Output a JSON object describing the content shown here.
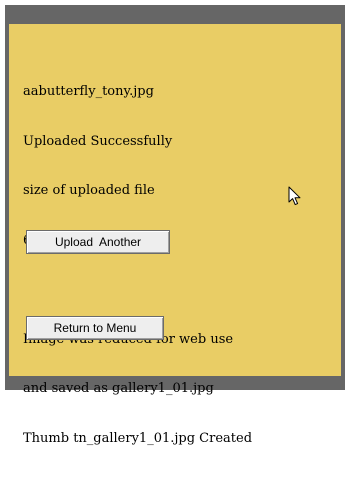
{
  "result": {
    "lines": [
      "aabutterfly_tony.jpg",
      "Uploaded Successfully",
      "size of uploaded file",
      "626 x 900",
      "",
      "Image was reduced for web use",
      "and saved as gallery1_01.jpg",
      "Thumb tn_gallery1_01.jpg Created"
    ]
  },
  "buttons": {
    "upload_another": "Upload  Another",
    "return_to_menu": "Return to Menu"
  },
  "colors": {
    "panel": "#e9cd65",
    "frame": "#666666"
  },
  "icons": {
    "pointer": "mouse-pointer-icon"
  }
}
